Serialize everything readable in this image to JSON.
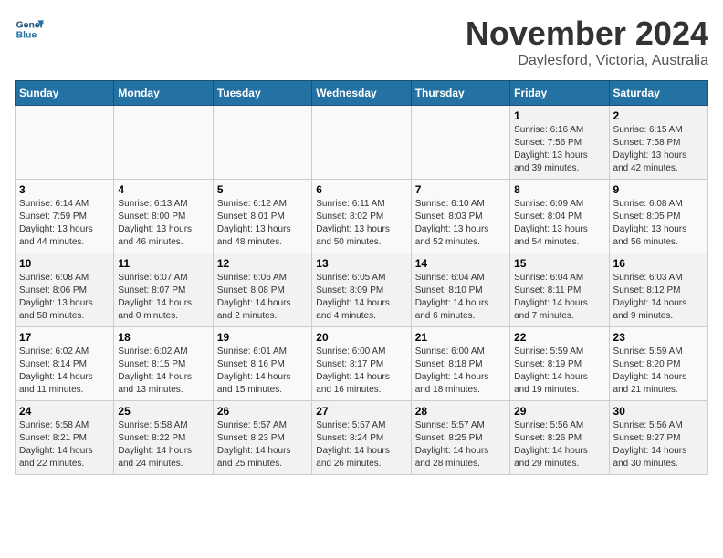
{
  "header": {
    "logo_line1": "General",
    "logo_line2": "Blue",
    "month_year": "November 2024",
    "location": "Daylesford, Victoria, Australia"
  },
  "weekdays": [
    "Sunday",
    "Monday",
    "Tuesday",
    "Wednesday",
    "Thursday",
    "Friday",
    "Saturday"
  ],
  "weeks": [
    [
      {
        "day": "",
        "info": ""
      },
      {
        "day": "",
        "info": ""
      },
      {
        "day": "",
        "info": ""
      },
      {
        "day": "",
        "info": ""
      },
      {
        "day": "",
        "info": ""
      },
      {
        "day": "1",
        "info": "Sunrise: 6:16 AM\nSunset: 7:56 PM\nDaylight: 13 hours\nand 39 minutes."
      },
      {
        "day": "2",
        "info": "Sunrise: 6:15 AM\nSunset: 7:58 PM\nDaylight: 13 hours\nand 42 minutes."
      }
    ],
    [
      {
        "day": "3",
        "info": "Sunrise: 6:14 AM\nSunset: 7:59 PM\nDaylight: 13 hours\nand 44 minutes."
      },
      {
        "day": "4",
        "info": "Sunrise: 6:13 AM\nSunset: 8:00 PM\nDaylight: 13 hours\nand 46 minutes."
      },
      {
        "day": "5",
        "info": "Sunrise: 6:12 AM\nSunset: 8:01 PM\nDaylight: 13 hours\nand 48 minutes."
      },
      {
        "day": "6",
        "info": "Sunrise: 6:11 AM\nSunset: 8:02 PM\nDaylight: 13 hours\nand 50 minutes."
      },
      {
        "day": "7",
        "info": "Sunrise: 6:10 AM\nSunset: 8:03 PM\nDaylight: 13 hours\nand 52 minutes."
      },
      {
        "day": "8",
        "info": "Sunrise: 6:09 AM\nSunset: 8:04 PM\nDaylight: 13 hours\nand 54 minutes."
      },
      {
        "day": "9",
        "info": "Sunrise: 6:08 AM\nSunset: 8:05 PM\nDaylight: 13 hours\nand 56 minutes."
      }
    ],
    [
      {
        "day": "10",
        "info": "Sunrise: 6:08 AM\nSunset: 8:06 PM\nDaylight: 13 hours\nand 58 minutes."
      },
      {
        "day": "11",
        "info": "Sunrise: 6:07 AM\nSunset: 8:07 PM\nDaylight: 14 hours\nand 0 minutes."
      },
      {
        "day": "12",
        "info": "Sunrise: 6:06 AM\nSunset: 8:08 PM\nDaylight: 14 hours\nand 2 minutes."
      },
      {
        "day": "13",
        "info": "Sunrise: 6:05 AM\nSunset: 8:09 PM\nDaylight: 14 hours\nand 4 minutes."
      },
      {
        "day": "14",
        "info": "Sunrise: 6:04 AM\nSunset: 8:10 PM\nDaylight: 14 hours\nand 6 minutes."
      },
      {
        "day": "15",
        "info": "Sunrise: 6:04 AM\nSunset: 8:11 PM\nDaylight: 14 hours\nand 7 minutes."
      },
      {
        "day": "16",
        "info": "Sunrise: 6:03 AM\nSunset: 8:12 PM\nDaylight: 14 hours\nand 9 minutes."
      }
    ],
    [
      {
        "day": "17",
        "info": "Sunrise: 6:02 AM\nSunset: 8:14 PM\nDaylight: 14 hours\nand 11 minutes."
      },
      {
        "day": "18",
        "info": "Sunrise: 6:02 AM\nSunset: 8:15 PM\nDaylight: 14 hours\nand 13 minutes."
      },
      {
        "day": "19",
        "info": "Sunrise: 6:01 AM\nSunset: 8:16 PM\nDaylight: 14 hours\nand 15 minutes."
      },
      {
        "day": "20",
        "info": "Sunrise: 6:00 AM\nSunset: 8:17 PM\nDaylight: 14 hours\nand 16 minutes."
      },
      {
        "day": "21",
        "info": "Sunrise: 6:00 AM\nSunset: 8:18 PM\nDaylight: 14 hours\nand 18 minutes."
      },
      {
        "day": "22",
        "info": "Sunrise: 5:59 AM\nSunset: 8:19 PM\nDaylight: 14 hours\nand 19 minutes."
      },
      {
        "day": "23",
        "info": "Sunrise: 5:59 AM\nSunset: 8:20 PM\nDaylight: 14 hours\nand 21 minutes."
      }
    ],
    [
      {
        "day": "24",
        "info": "Sunrise: 5:58 AM\nSunset: 8:21 PM\nDaylight: 14 hours\nand 22 minutes."
      },
      {
        "day": "25",
        "info": "Sunrise: 5:58 AM\nSunset: 8:22 PM\nDaylight: 14 hours\nand 24 minutes."
      },
      {
        "day": "26",
        "info": "Sunrise: 5:57 AM\nSunset: 8:23 PM\nDaylight: 14 hours\nand 25 minutes."
      },
      {
        "day": "27",
        "info": "Sunrise: 5:57 AM\nSunset: 8:24 PM\nDaylight: 14 hours\nand 26 minutes."
      },
      {
        "day": "28",
        "info": "Sunrise: 5:57 AM\nSunset: 8:25 PM\nDaylight: 14 hours\nand 28 minutes."
      },
      {
        "day": "29",
        "info": "Sunrise: 5:56 AM\nSunset: 8:26 PM\nDaylight: 14 hours\nand 29 minutes."
      },
      {
        "day": "30",
        "info": "Sunrise: 5:56 AM\nSunset: 8:27 PM\nDaylight: 14 hours\nand 30 minutes."
      }
    ]
  ]
}
